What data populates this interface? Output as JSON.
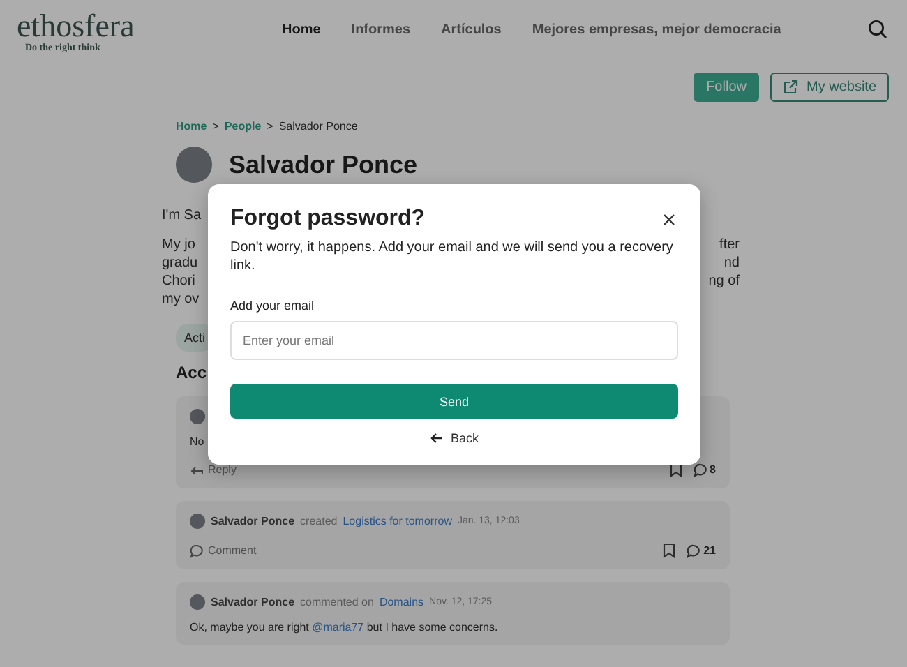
{
  "header": {
    "logo": "ethosfera",
    "tagline": "Do the right think",
    "nav": [
      {
        "label": "Home",
        "selected": true
      },
      {
        "label": "Informes",
        "selected": false
      },
      {
        "label": "Artículos",
        "selected": false
      },
      {
        "label": "Mejores empresas, mejor democracia",
        "selected": false
      }
    ]
  },
  "actions": {
    "follow": "Follow",
    "website": "My website"
  },
  "breadcrumb": {
    "separator": ">",
    "items": [
      {
        "label": "Home",
        "kind": "link"
      },
      {
        "label": "People",
        "kind": "link"
      },
      {
        "label": "Salvador Ponce",
        "kind": "current"
      }
    ]
  },
  "profile": {
    "name": "Salvador Ponce",
    "bio_lines": [
      {
        "left": "I'm Sa"
      },
      {
        "left": "My jo",
        "right": "fter"
      },
      {
        "left": "gradu",
        "right": "nd"
      },
      {
        "left": "Chori",
        "right": "ng of"
      },
      {
        "left": "my ov"
      }
    ],
    "tag": "Acti",
    "section_heading": "Acc"
  },
  "activity": [
    {
      "kind": "reply",
      "text": "No",
      "action": "Reply",
      "count": "8"
    },
    {
      "kind": "comment",
      "author": "Salvador Ponce",
      "verb": "created",
      "target": "Logistics for tomorrow",
      "date": "Jan. 13, 12:03",
      "action": "Comment",
      "count": "21"
    },
    {
      "kind": "post",
      "author": "Salvador Ponce",
      "verb": "commented on",
      "target": "Domains",
      "date": "Nov. 12, 17:25",
      "text_before": "Ok, maybe you are right",
      "mention": "@maria77",
      "text_after": "but I have some concerns."
    }
  ],
  "modal": {
    "title": "Forgot password?",
    "description": "Don't worry, it happens. Add your email and we will send you a recovery link.",
    "field_label": "Add your email",
    "placeholder": "Enter your email",
    "submit": "Send",
    "back": "Back"
  }
}
